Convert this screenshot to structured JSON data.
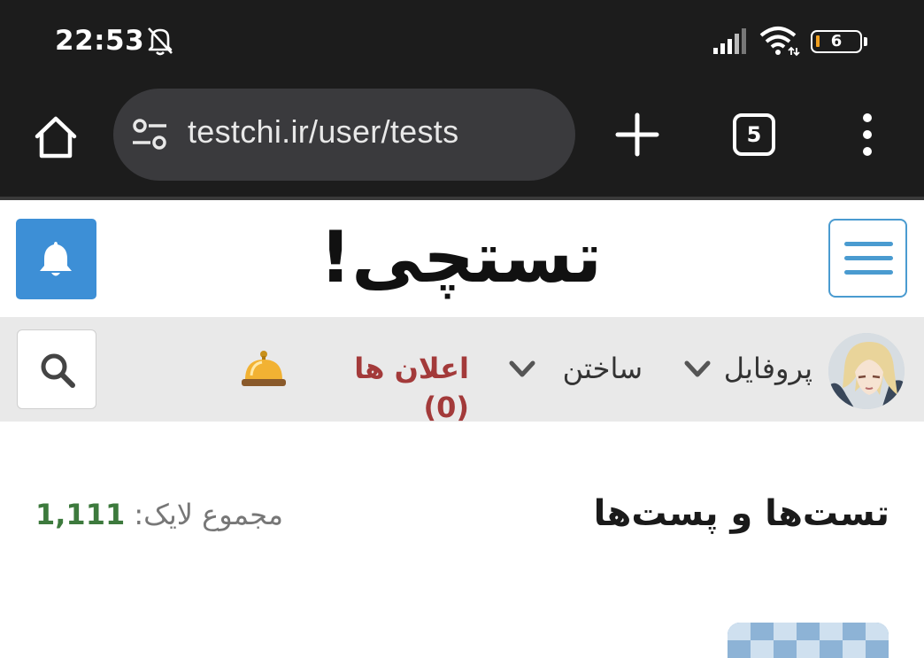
{
  "status_bar": {
    "time": "22:53",
    "battery_level": "6",
    "icons": [
      "mute-bell-icon",
      "signal-icon",
      "wifi-icon",
      "battery-icon"
    ]
  },
  "browser": {
    "url": "testchi.ir/user/tests",
    "tab_count": "5",
    "icons": [
      "home-icon",
      "tune-icon",
      "plus-icon",
      "tabs-icon",
      "more-vert-icon"
    ]
  },
  "site": {
    "logo": "تستچی!",
    "accent_color": "#3d8fd6"
  },
  "nav": {
    "profile": "پروفایل",
    "build": "ساختن",
    "notifications": "اعلان ها (0)",
    "notification_color": "#a33a3a"
  },
  "content": {
    "title": "تست‌ها و پست‌ها",
    "likes_label": "مجموع لایک:",
    "likes_value": "1,111",
    "likes_color": "#3d7a3d"
  }
}
